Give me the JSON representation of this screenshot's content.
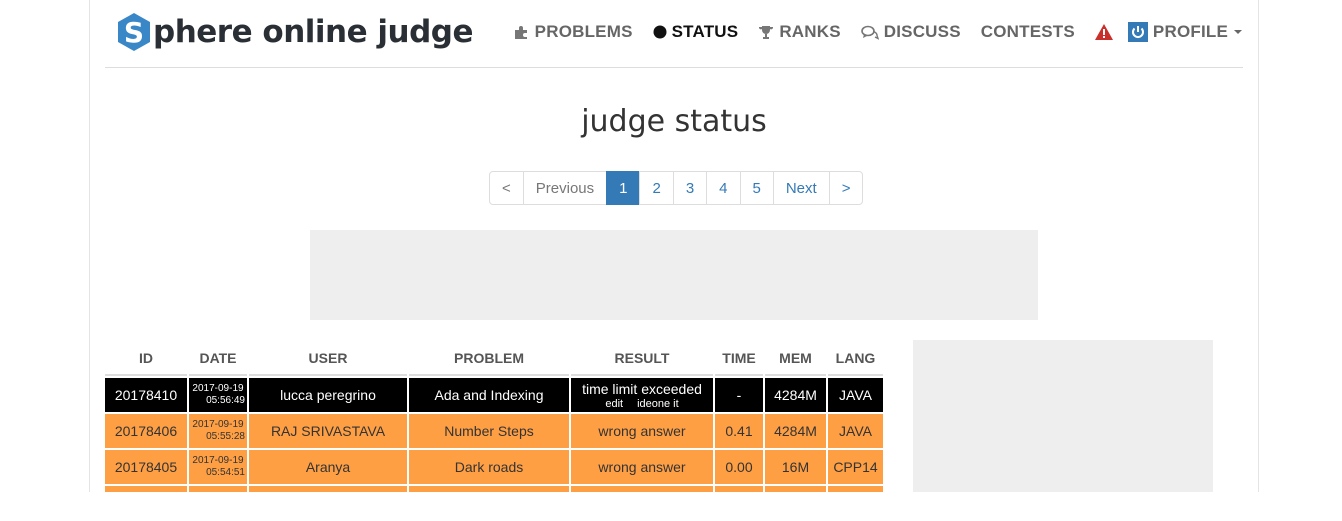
{
  "brand": {
    "logo_letter": "S",
    "name": "phere online judge",
    "hex_color": "#3a87c8"
  },
  "nav": {
    "items": [
      {
        "label": "PROBLEMS",
        "icon": "puzzle-icon"
      },
      {
        "label": "STATUS",
        "icon": "circle-icon",
        "active": true
      },
      {
        "label": "RANKS",
        "icon": "trophy-icon"
      },
      {
        "label": "DISCUSS",
        "icon": "comments-icon"
      },
      {
        "label": "CONTESTS",
        "icon": ""
      }
    ],
    "alert_icon": "warning-icon",
    "profile": {
      "label": "PROFILE",
      "icon": "power-icon"
    }
  },
  "page": {
    "title": "judge status"
  },
  "pagination": {
    "first": "<",
    "previous": "Previous",
    "pages": [
      "1",
      "2",
      "3",
      "4",
      "5"
    ],
    "current": "1",
    "next": "Next",
    "last": ">"
  },
  "table": {
    "headers": [
      "ID",
      "DATE",
      "USER",
      "PROBLEM",
      "RESULT",
      "TIME",
      "MEM",
      "LANG"
    ],
    "rows": [
      {
        "id": "20178410",
        "date": "2017-09-19",
        "time_of_day": "05:56:49",
        "user": "lucca peregrino",
        "problem": "Ada and Indexing",
        "result": "time limit exceeded",
        "result_links": [
          "edit",
          "ideone it"
        ],
        "time": "-",
        "mem": "4284M",
        "lang": "JAVA",
        "style": "black"
      },
      {
        "id": "20178406",
        "date": "2017-09-19",
        "time_of_day": "05:55:28",
        "user": "RAJ SRIVASTAVA",
        "problem": "Number Steps",
        "result": "wrong answer",
        "time": "0.41",
        "mem": "4284M",
        "lang": "JAVA",
        "style": "orange"
      },
      {
        "id": "20178405",
        "date": "2017-09-19",
        "time_of_day": "05:54:51",
        "user": "Aranya",
        "problem": "Dark roads",
        "result": "wrong answer",
        "time": "0.00",
        "mem": "16M",
        "lang": "CPP14",
        "style": "orange"
      }
    ]
  },
  "colors": {
    "link": "#337ab7",
    "row_orange": "#ff9f44",
    "row_black": "#000000",
    "warning": "#c9302c"
  }
}
